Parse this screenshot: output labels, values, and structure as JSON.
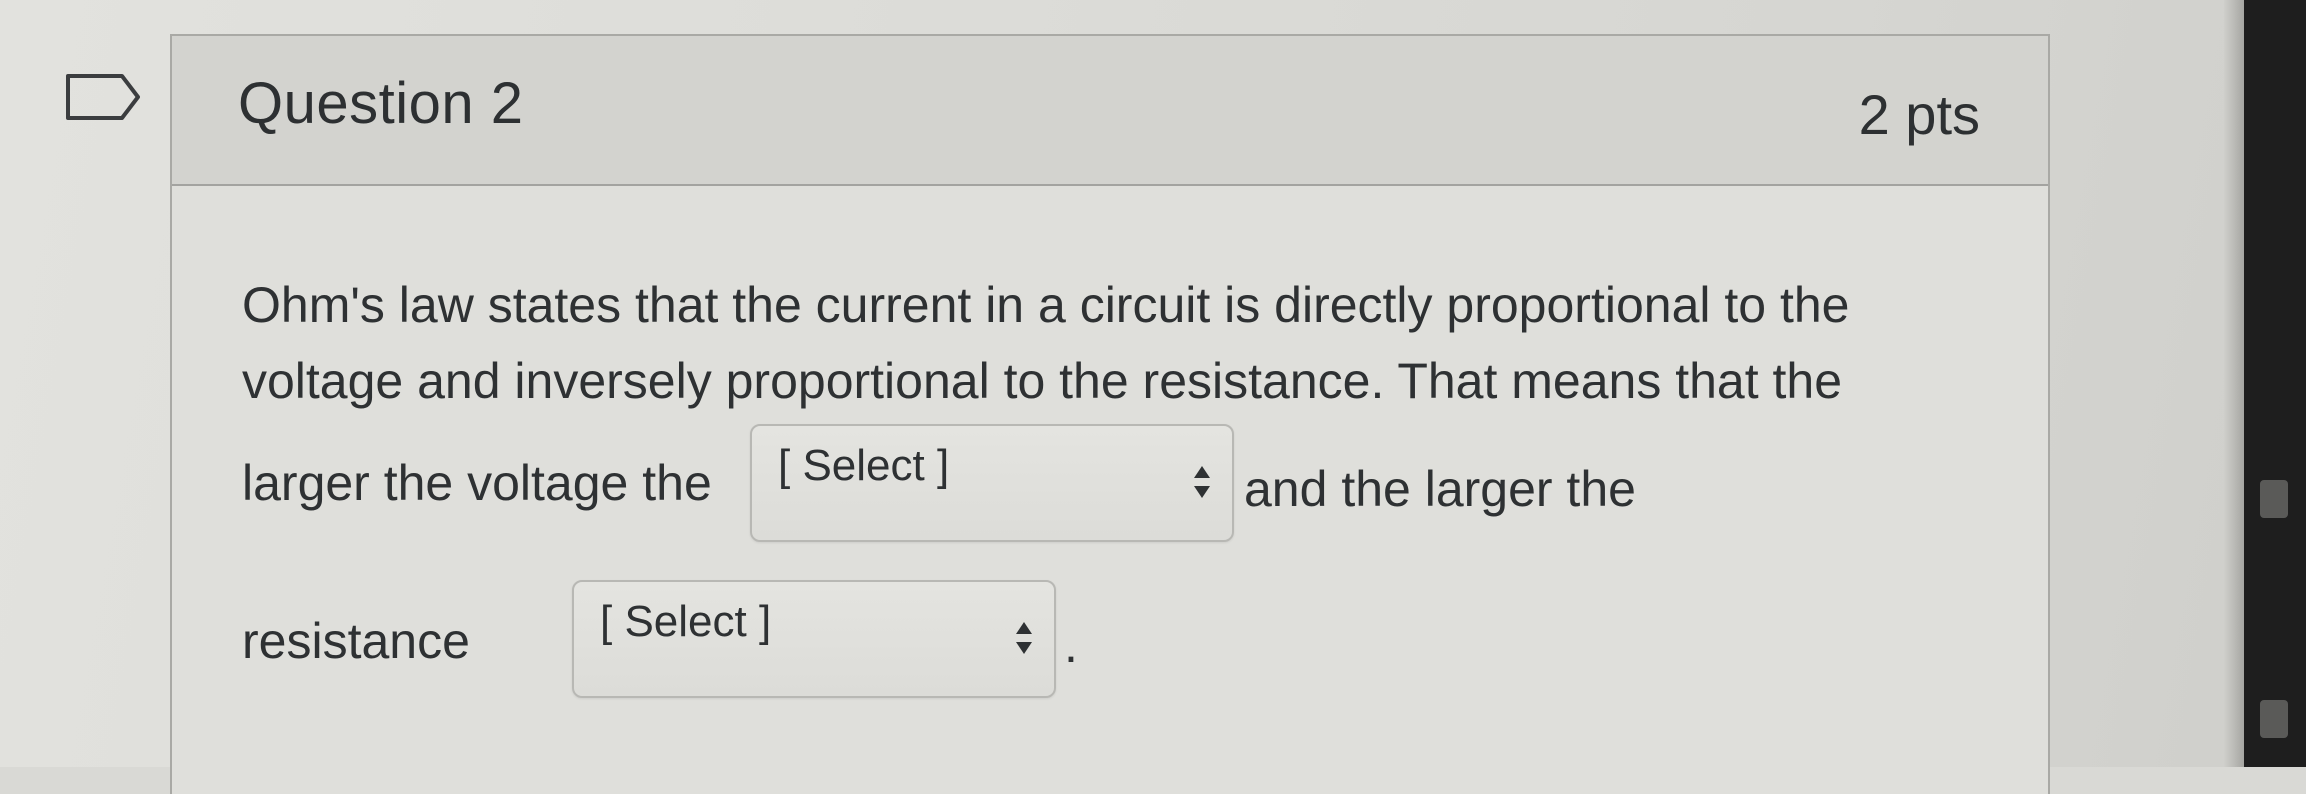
{
  "question": {
    "title": "Question 2",
    "points": "2 pts",
    "flag_icon": "flag-outline-icon",
    "lines": [
      "Ohm's law states that the current in a circuit is directly proportional to the",
      "voltage and inversely proportional to the resistance. That means that the",
      "larger the voltage the",
      "and the larger the",
      "resistance"
    ],
    "period": ".",
    "dropdowns": [
      {
        "selected": "[ Select ]",
        "icon": "sort-arrows-icon"
      },
      {
        "selected": "[ Select ]",
        "icon": "sort-arrows-icon"
      }
    ]
  }
}
